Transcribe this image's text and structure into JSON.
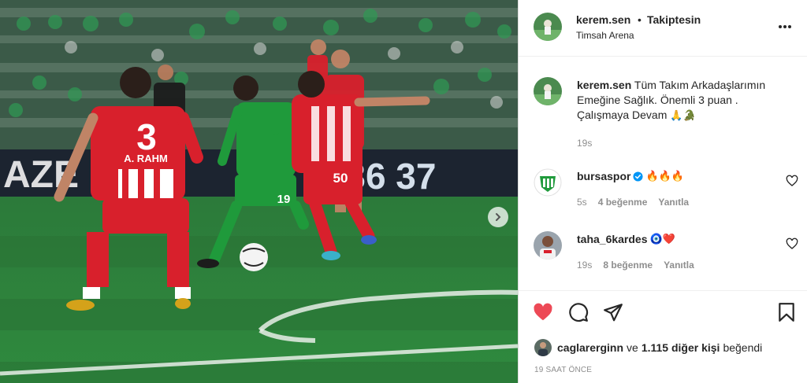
{
  "post": {
    "author": "kerem.sen",
    "separator": "•",
    "follow_status": "Takiptesin",
    "location": "Timsah Arena",
    "caption": "Tüm Takım Arkadaşlarımın Emeğine Sağlık. Önemli 3 puan . Çalışmaya Devam",
    "caption_emojis": "🙏🐊",
    "caption_time": "19s",
    "likes_user": "caglarerginn",
    "likes_and": "ve",
    "likes_others": "1.115 diğer kişi",
    "likes_suffix": "beğendi",
    "posted_ago": "19 SAAT ÖNCE"
  },
  "photo": {
    "scoreboard_left": "AZE",
    "scoreboard_right": "8 36 37",
    "jersey_left_number": "3",
    "jersey_left_name": "A. RAHM",
    "jersey_green_number": "19",
    "jersey_red_number": "50"
  },
  "comments": [
    {
      "user": "bursaspor",
      "verified": true,
      "text": "🔥🔥🔥",
      "time": "5s",
      "likes": "4 beğenme",
      "reply": "Yanıtla"
    },
    {
      "user": "taha_6kardes",
      "verified": false,
      "text": "🧿❤️",
      "time": "19s",
      "likes": "8 beğenme",
      "reply": "Yanıtla"
    }
  ],
  "icons": {
    "more": "more-options-icon",
    "like": "heart-filled-icon",
    "comment": "comment-bubble-icon",
    "share": "paper-plane-icon",
    "save": "bookmark-icon",
    "next": "chevron-right-icon"
  },
  "colors": {
    "like_red": "#ed4956",
    "verified_blue": "#0095f6",
    "text_primary": "#262626",
    "text_secondary": "#8e8e8e",
    "bursaspor_green": "#1f9a3b",
    "sivasspor_red": "#d8202c"
  }
}
